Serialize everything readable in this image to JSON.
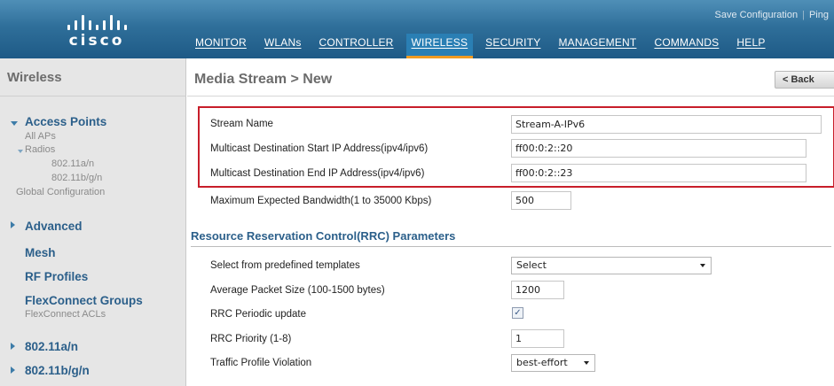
{
  "header": {
    "logo_text": "cisco",
    "top_links": {
      "save_configuration": "Save Configuration",
      "ping": "Ping"
    },
    "nav": [
      {
        "label": "MONITOR",
        "active": false
      },
      {
        "label": "WLANs",
        "active": false
      },
      {
        "label": "CONTROLLER",
        "active": false
      },
      {
        "label": "WIRELESS",
        "active": true
      },
      {
        "label": "SECURITY",
        "active": false
      },
      {
        "label": "MANAGEMENT",
        "active": false
      },
      {
        "label": "COMMANDS",
        "active": false
      },
      {
        "label": "HELP",
        "active": false
      }
    ]
  },
  "sidebar": {
    "title": "Wireless",
    "access_points": "Access Points",
    "all_aps": "All APs",
    "radios": "Radios",
    "radio_80211an": "802.11a/n",
    "radio_80211bgn": "802.11b/g/n",
    "global_configuration": "Global Configuration",
    "advanced": "Advanced",
    "mesh": "Mesh",
    "rf_profiles": "RF Profiles",
    "flexconnect_groups": "FlexConnect Groups",
    "flexconnect_acls": "FlexConnect ACLs",
    "section_80211an": "802.11a/n",
    "section_80211bgn": "802.11b/g/n"
  },
  "main": {
    "page_title": "Media Stream > New",
    "back_label": "< Back",
    "stream_fields": [
      {
        "label": "Stream Name",
        "value": "Stream-A-IPv6"
      },
      {
        "label": "Multicast Destination Start IP Address(ipv4/ipv6)",
        "value": "ff00:0:2::20"
      },
      {
        "label": "Multicast Destination End IP Address(ipv4/ipv6)",
        "value": "ff00:0:2::23"
      },
      {
        "label": "Maximum Expected Bandwidth(1 to 35000 Kbps)",
        "value": "500"
      }
    ],
    "rrc_heading": "Resource Reservation Control(RRC) Parameters",
    "rrc": {
      "template_label": "Select from predefined templates",
      "template_value": "Select",
      "avg_packet_label": "Average Packet Size (100-1500 bytes)",
      "avg_packet_value": "1200",
      "periodic_update_label": "RRC Periodic update",
      "periodic_update_checked": true,
      "priority_label": "RRC Priority (1-8)",
      "priority_value": "1",
      "violation_label": "Traffic Profile Violation",
      "violation_value": "best-effort"
    }
  },
  "colors": {
    "header_blue": "#1e5a86",
    "active_tab_underline": "#f09b22",
    "highlight_red": "#c81e2a",
    "link_blue": "#2b5f8a"
  }
}
